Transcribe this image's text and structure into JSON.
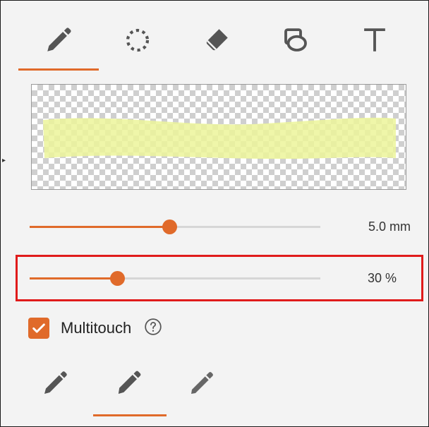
{
  "tools": {
    "tabs": [
      {
        "name": "pen",
        "icon": "pencil-icon",
        "selected": true
      },
      {
        "name": "lasso",
        "icon": "lasso-icon",
        "selected": false
      },
      {
        "name": "eraser",
        "icon": "eraser-icon",
        "selected": false
      },
      {
        "name": "shapes",
        "icon": "shapes-icon",
        "selected": false
      },
      {
        "name": "text",
        "icon": "text-icon",
        "selected": false
      }
    ]
  },
  "preview": {
    "stroke_color": "#ecf59a",
    "stroke_opacity": 0.3
  },
  "sliders": {
    "size": {
      "value_label": "5.0 mm",
      "fraction": 0.48
    },
    "opacity": {
      "value_label": "30 %",
      "fraction": 0.3
    }
  },
  "multitouch": {
    "label": "Multitouch",
    "checked": true
  },
  "pen_types": {
    "items": [
      {
        "name": "fountain-pen",
        "selected": false
      },
      {
        "name": "marker",
        "selected": true
      },
      {
        "name": "highlighter",
        "selected": false
      }
    ]
  },
  "colors": {
    "accent": "#e06a2a",
    "highlight_box": "#e01b1b",
    "icon": "#555555"
  }
}
